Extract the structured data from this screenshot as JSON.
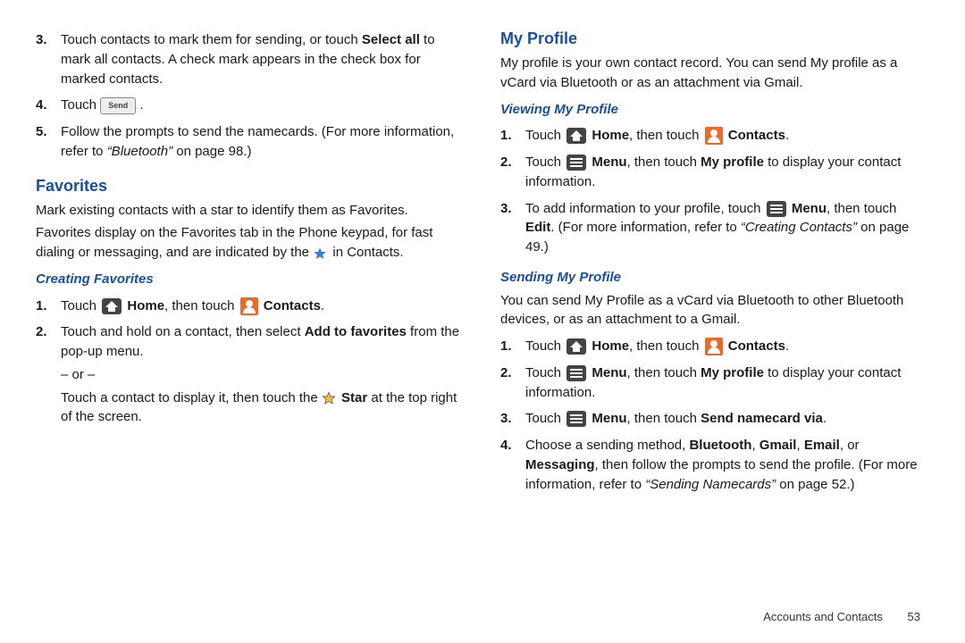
{
  "left": {
    "l3": {
      "pre": "Touch contacts to mark them for sending, or touch ",
      "b1": "Select all",
      "post": " to mark all contacts. A check mark appears in the check box for marked contacts."
    },
    "l4": {
      "touch": "Touch ",
      "send_label": "Send",
      "dot": " ."
    },
    "l5": {
      "text": "Follow the prompts to send the namecards. (For more information, refer to ",
      "ref": "“Bluetooth”",
      "post": " on page 98.)"
    },
    "fav_h": "Favorites",
    "fav_p1": "Mark existing contacts with a star to identify them as Favorites.",
    "fav_p2a": "Favorites display on the Favorites tab in the Phone keypad, for fast dialing or messaging, and are indicated by the ",
    "fav_p2b": " in Contacts.",
    "creating_h": "Creating Favorites",
    "c1_a": "Touch ",
    "c1_home": " Home",
    "c1_b": ", then touch ",
    "c1_contacts": " Contacts",
    "c1_dot": ".",
    "c2_a": "Touch and hold on a contact, then select ",
    "c2_b": "Add to favorites",
    "c2_c": " from the pop-up menu.",
    "or": "– or –",
    "c2_d": "Touch a contact to display it, then touch the ",
    "c2_star": " Star",
    "c2_e": " at the top right of the screen."
  },
  "right": {
    "myprofile_h": "My Profile",
    "mp_p": "My profile is your own contact record. You can send My profile as a vCard via Bluetooth or as an attachment via Gmail.",
    "view_h": "Viewing My Profile",
    "v1_a": "Touch ",
    "v1_home": " Home",
    "v1_b": ", then touch ",
    "v1_contacts": " Contacts",
    "v1_dot": ".",
    "v2_a": "Touch ",
    "v2_menu": " Menu",
    "v2_b": ", then touch ",
    "v2_mp": "My profile",
    "v2_c": " to display your contact information.",
    "v3_a": "To add information to your profile, touch ",
    "v3_menu": " Menu",
    "v3_b": ", then touch ",
    "v3_edit": "Edit",
    "v3_c": ". (For more information, refer to ",
    "v3_ref": "“Creating Contacts”",
    "v3_d": " on page 49.)",
    "send_h": "Sending My Profile",
    "sp_p": "You can send My Profile as a vCard via Bluetooth to other Bluetooth devices, or as an attachment to a Gmail.",
    "s1_a": "Touch ",
    "s1_home": " Home",
    "s1_b": ", then touch ",
    "s1_contacts": " Contacts",
    "s1_dot": ".",
    "s2_a": "Touch ",
    "s2_menu": " Menu",
    "s2_b": ", then touch ",
    "s2_mp": "My profile",
    "s2_c": " to display your contact information.",
    "s3_a": "Touch ",
    "s3_menu": " Menu",
    "s3_b": ", then touch ",
    "s3_via": "Send namecard via",
    "s3_dot": ".",
    "s4_a": "Choose a sending method, ",
    "s4_bt": "Bluetooth",
    "s4_com1": ", ",
    "s4_gm": "Gmail",
    "s4_com2": ", ",
    "s4_em": "Email",
    "s4_or": ", or ",
    "s4_msg": "Messaging",
    "s4_b": ", then follow the prompts to send the profile. (For more information, refer to ",
    "s4_ref": "“Sending Namecards”",
    "s4_c": " on page 52.)"
  },
  "footer": {
    "section": "Accounts and Contacts",
    "page": "53"
  }
}
